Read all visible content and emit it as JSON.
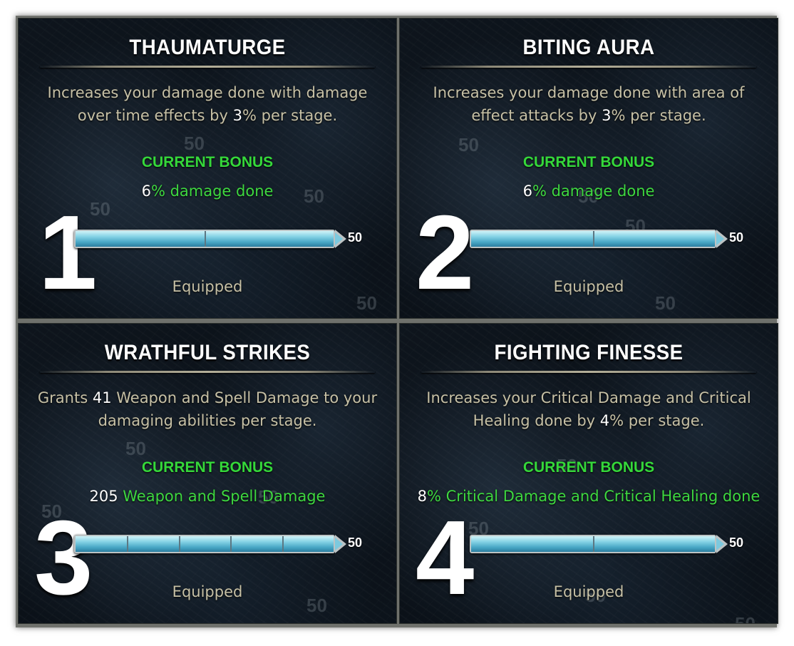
{
  "panels": [
    {
      "index": "1",
      "title": "THAUMATURGE",
      "description": {
        "before": "Increases your damage done with damage over time effects by ",
        "value": "3",
        "after": "% per stage."
      },
      "current_bonus_label": "CURRENT BONUS",
      "current_bonus": {
        "value": "6",
        "text": "% damage done"
      },
      "bar": {
        "fill_fraction": 1.0,
        "stages": 2,
        "max_label": "50"
      },
      "status": "Equipped"
    },
    {
      "index": "2",
      "title": "BITING AURA",
      "description": {
        "before": "Increases your damage done with area of effect attacks by ",
        "value": "3",
        "after": "% per stage."
      },
      "current_bonus_label": "CURRENT BONUS",
      "current_bonus": {
        "value": "6",
        "text": "% damage done"
      },
      "bar": {
        "fill_fraction": 1.0,
        "stages": 2,
        "max_label": "50"
      },
      "status": "Equipped"
    },
    {
      "index": "3",
      "title": "WRATHFUL STRIKES",
      "description": {
        "before": "Grants ",
        "value": "41",
        "after": " Weapon and Spell Damage to your damaging abilities per stage."
      },
      "current_bonus_label": "CURRENT BONUS",
      "current_bonus": {
        "value": "205",
        "text": " Weapon and Spell Damage"
      },
      "bar": {
        "fill_fraction": 1.0,
        "stages": 5,
        "max_label": "50"
      },
      "status": "Equipped"
    },
    {
      "index": "4",
      "title": "FIGHTING FINESSE",
      "description": {
        "before": "Increases your Critical Damage and Critical Healing done by ",
        "value": "4",
        "after": "% per stage."
      },
      "current_bonus_label": "CURRENT BONUS",
      "current_bonus": {
        "value": "8",
        "text": "% Critical Damage and Critical Healing done"
      },
      "bar": {
        "fill_fraction": 1.0,
        "stages": 2,
        "max_label": "50"
      },
      "status": "Equipped"
    }
  ],
  "background_labels": [
    "50",
    "50",
    "50",
    "50"
  ],
  "colors": {
    "bonus_green": "#35d83a",
    "description_tan": "#c7c1a6",
    "bar_blue": "#86d3e5"
  }
}
